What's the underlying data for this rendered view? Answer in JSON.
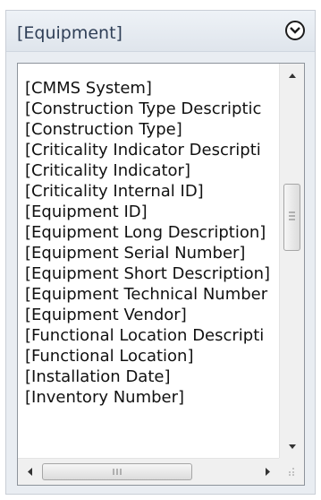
{
  "header": {
    "title": "[Equipment]",
    "collapse_icon": "chevron-down-icon"
  },
  "list": {
    "items": [
      "[CMMS System]",
      "[Construction Type Descriptic",
      "[Construction Type]",
      "[Criticality Indicator Descripti",
      "[Criticality Indicator]",
      "[Criticality Internal ID]",
      "[Equipment ID]",
      "[Equipment Long Description]",
      "[Equipment Serial Number]",
      "[Equipment Short Description]",
      "[Equipment Technical Number",
      "[Equipment Vendor]",
      "[Functional Location Descripti",
      "[Functional Location]",
      "[Installation Date]",
      "[Inventory Number]"
    ]
  },
  "colors": {
    "panel_bg": "#e9edf2",
    "title_text": "#2f3f57"
  }
}
